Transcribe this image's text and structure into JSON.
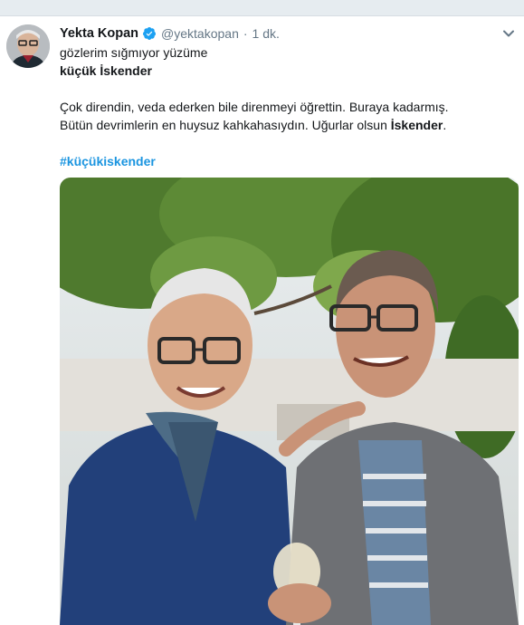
{
  "tweet": {
    "author_name": "Yekta Kopan",
    "author_handle": "@yektakopan",
    "separator": "·",
    "timestamp": "1 dk.",
    "lines": {
      "line1": "gözlerim sığmıyor yüzüme",
      "line2": "küçük İskender",
      "para_part1": "Çok direndin, veda ederken bile direnmeyi öğrettin. Buraya kadarmış. Bütün devrimlerin en huysuz kahkahasıydın. Uğurlar olsun ",
      "para_bold": "İskender",
      "para_end": "."
    },
    "hashtag": "#küçükiskender",
    "verified_icon": "verified-badge-icon",
    "menu_icon": "chevron-down-icon",
    "colors": {
      "link": "#1b95e0",
      "verified": "#1da1f2",
      "muted": "#657786"
    }
  }
}
